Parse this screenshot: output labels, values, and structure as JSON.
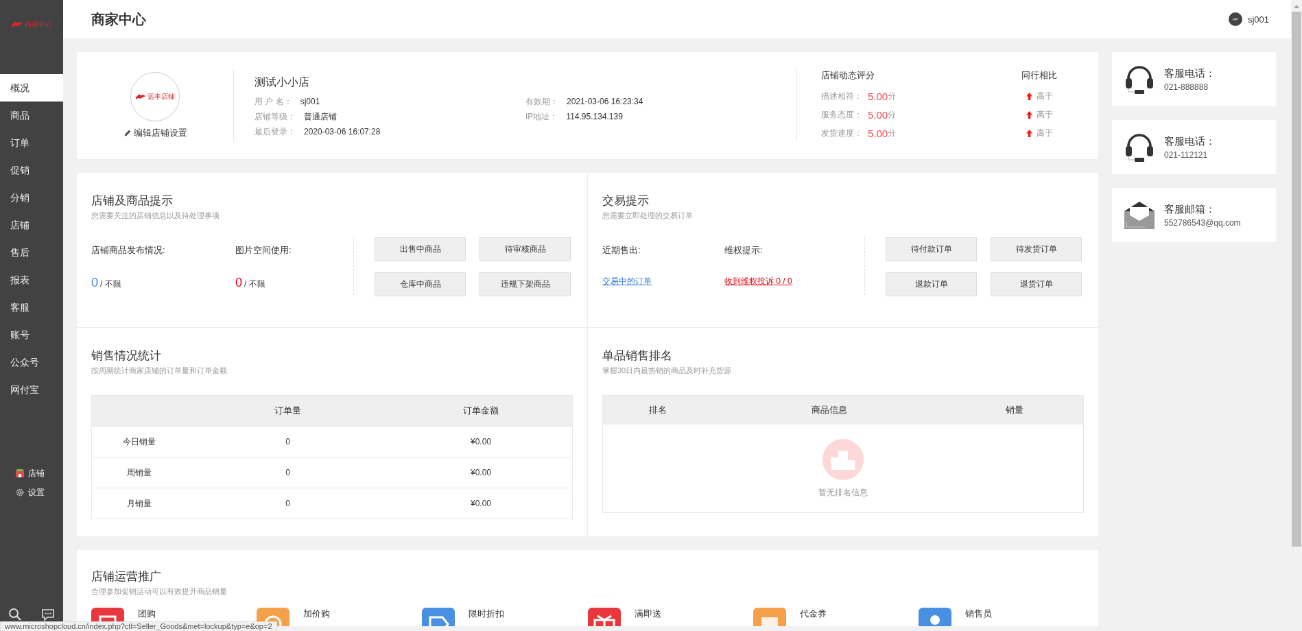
{
  "sidebar": {
    "logo_text": "商家中心",
    "items": [
      {
        "label": "概况",
        "selected": true
      },
      {
        "label": "商品",
        "selected": false
      },
      {
        "label": "订单",
        "selected": false
      },
      {
        "label": "促销",
        "selected": false
      },
      {
        "label": "分销",
        "selected": false
      },
      {
        "label": "店铺",
        "selected": false
      },
      {
        "label": "售后",
        "selected": false
      },
      {
        "label": "报表",
        "selected": false
      },
      {
        "label": "客服",
        "selected": false
      },
      {
        "label": "账号",
        "selected": false
      },
      {
        "label": "公众号",
        "selected": false
      },
      {
        "label": "网付宝",
        "selected": false
      }
    ],
    "footer_links": [
      {
        "label": "店铺",
        "kind": "store"
      },
      {
        "label": "设置",
        "kind": "settings"
      }
    ]
  },
  "header": {
    "title": "商家中心",
    "user": "sj001"
  },
  "store": {
    "logo_text": "远丰店铺",
    "edit_link": "编辑店铺设置",
    "name": "测试小小店",
    "info_columns": [
      [
        {
          "label": "用 户 名：",
          "value": "sj001"
        },
        {
          "label": "店铺等级：",
          "value": "普通店铺"
        },
        {
          "label": "最后登录：",
          "value": "2020-03-06 16:07:28"
        }
      ],
      [
        {
          "label": "有效期：",
          "value": "2021-03-06 16:23:34"
        },
        {
          "label": "IP地址：",
          "value": "114.95.134.139"
        }
      ]
    ]
  },
  "ratings": {
    "title": "店铺动态评分",
    "compare_title": "同行相比",
    "rows": [
      {
        "label": "描述相符：",
        "score": "5.00",
        "unit": "分",
        "compare": "高于"
      },
      {
        "label": "服务态度：",
        "score": "5.00",
        "unit": "分",
        "compare": "高于"
      },
      {
        "label": "发货速度：",
        "score": "5.00",
        "unit": "分",
        "compare": "高于"
      }
    ]
  },
  "contacts": [
    {
      "kind": "phone",
      "label": "客服电话：",
      "value": "021-888888"
    },
    {
      "kind": "phone",
      "label": "客服电话：",
      "value": "021-112121"
    },
    {
      "kind": "email",
      "label": "客服邮箱：",
      "value": "552786543@qq.com"
    }
  ],
  "store_tips": {
    "title": "店铺及商品提示",
    "subtitle": "您需要关注的店铺信息以及待处理事项",
    "stats": [
      {
        "label": "店铺商品发布情况:",
        "count": "0",
        "limit": "/ 不限",
        "color": "#4a86e8"
      },
      {
        "label": "图片空间使用:",
        "count": "0",
        "limit": "/ 不限",
        "color": "#e60012"
      }
    ],
    "buttons": [
      "出售中商品",
      "待审核商品",
      "仓库中商品",
      "违规下架商品"
    ]
  },
  "trade_tips": {
    "title": "交易提示",
    "subtitle": "您需要立即处理的交易订单",
    "stats": [
      {
        "label": "近期售出:",
        "link": "交易中的订单",
        "color": "#3b7dd8"
      },
      {
        "label": "维权提示:",
        "link": "收到维权投诉 0 / 0",
        "color": "#e60012"
      }
    ],
    "buttons": [
      "待付款订单",
      "待发货订单",
      "退款订单",
      "退货订单"
    ]
  },
  "sales_stats": {
    "title": "销售情况统计",
    "subtitle": "按周期统计商家店铺的订单量和订单金额",
    "columns": [
      "",
      "订单量",
      "订单金额"
    ],
    "rows": [
      [
        "今日销量",
        "0",
        "¥0.00"
      ],
      [
        "周销量",
        "0",
        "¥0.00"
      ],
      [
        "月销量",
        "0",
        "¥0.00"
      ]
    ]
  },
  "ranking": {
    "title": "单品销售排名",
    "subtitle": "掌握30日内最热销的商品及时补充货源",
    "columns": [
      "排名",
      "商品信息",
      "销量"
    ],
    "empty_text": "暂无排名信息"
  },
  "promotion": {
    "title": "店铺运营推广",
    "subtitle": "合理参加促销活动可以有效提升商品销量",
    "items": [
      {
        "label": "团购",
        "kind": "group",
        "color": "#e8383d"
      },
      {
        "label": "加价购",
        "kind": "addon",
        "color": "#f5a04a"
      },
      {
        "label": "限时折扣",
        "kind": "discount",
        "color": "#4a90e2"
      },
      {
        "label": "满即送",
        "kind": "gift",
        "color": "#e8383d"
      },
      {
        "label": "代金券",
        "kind": "voucher",
        "color": "#f5a04a"
      },
      {
        "label": "销售员",
        "kind": "seller",
        "color": "#4a90e2"
      }
    ]
  },
  "status_url": "www.microshopcloud.cn/index.php?ctl=Seller_Goods&met=lockup&typ=e&op=2"
}
